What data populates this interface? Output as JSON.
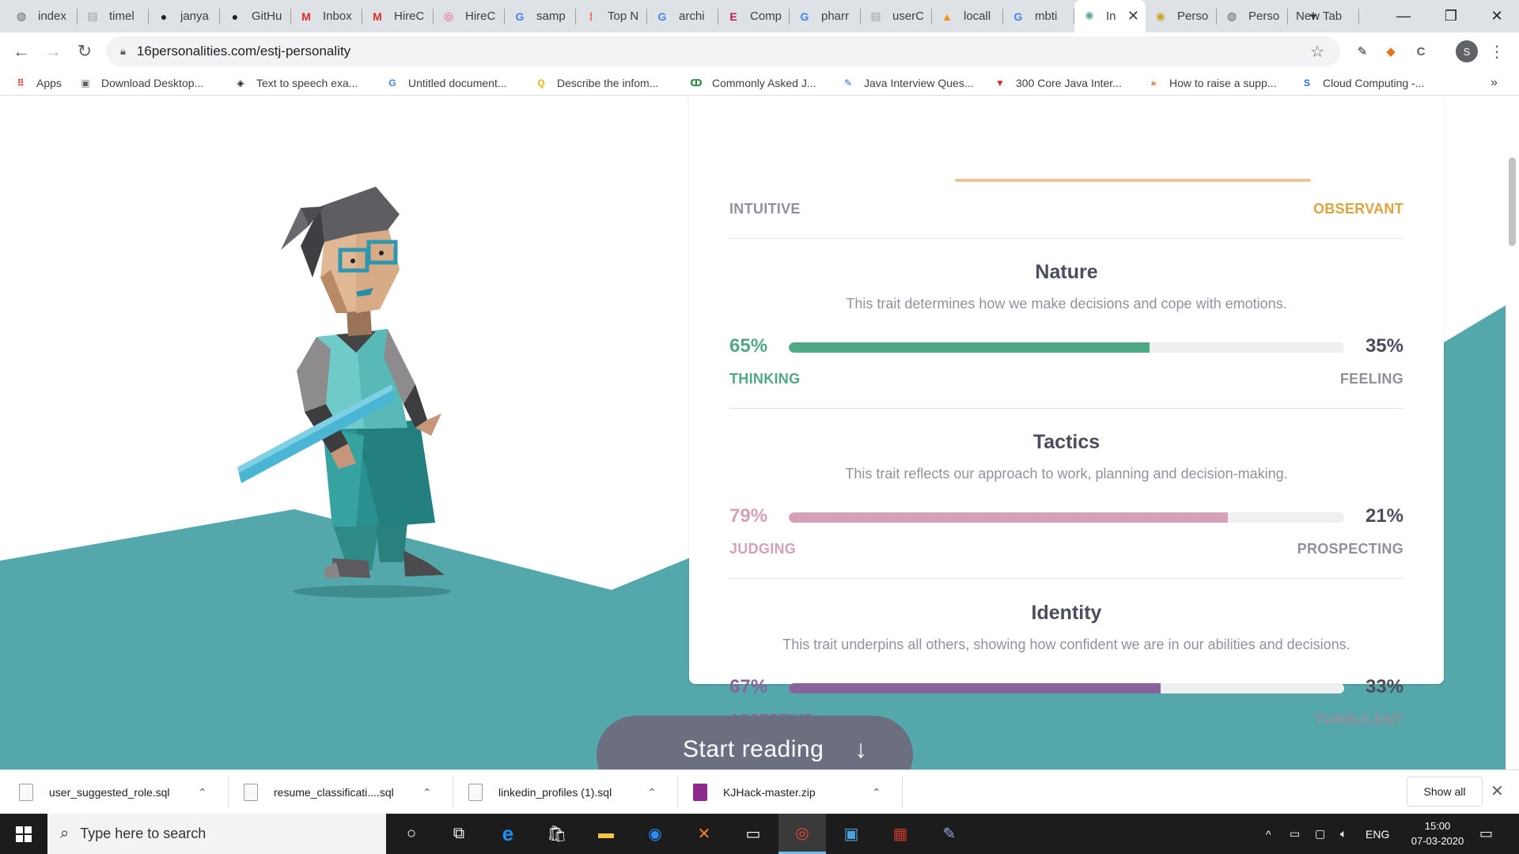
{
  "browser": {
    "tabs": [
      {
        "label": "index",
        "icon": "globe-icon",
        "glyph": "◍",
        "color": "#5f6368"
      },
      {
        "label": "timel",
        "icon": "doc-icon",
        "glyph": "▤",
        "color": "#9aa0a6"
      },
      {
        "label": "janya",
        "icon": "github-icon",
        "glyph": "●",
        "color": "#202124"
      },
      {
        "label": "GitHu",
        "icon": "github-icon",
        "glyph": "●",
        "color": "#202124"
      },
      {
        "label": "Inbox",
        "icon": "gmail-icon",
        "glyph": "M",
        "color": "#d93025"
      },
      {
        "label": "HireC",
        "icon": "gmail-icon",
        "glyph": "M",
        "color": "#d93025"
      },
      {
        "label": "HireC",
        "icon": "dribbble-icon",
        "glyph": "◎",
        "color": "#ea4c89"
      },
      {
        "label": "samp",
        "icon": "google-icon",
        "glyph": "G",
        "color": "#4285f4"
      },
      {
        "label": "Top N",
        "icon": "chart-icon",
        "glyph": "⁞",
        "color": "#f4511e"
      },
      {
        "label": "archi",
        "icon": "google-icon",
        "glyph": "G",
        "color": "#4285f4"
      },
      {
        "label": "Comp",
        "icon": "e-icon",
        "glyph": "E",
        "color": "#c2185b"
      },
      {
        "label": "pharr",
        "icon": "google-icon",
        "glyph": "G",
        "color": "#4285f4"
      },
      {
        "label": "userC",
        "icon": "doc-icon",
        "glyph": "▤",
        "color": "#9aa0a6"
      },
      {
        "label": "locall",
        "icon": "pma-icon",
        "glyph": "▲",
        "color": "#f29111"
      },
      {
        "label": "mbti",
        "icon": "google-icon",
        "glyph": "G",
        "color": "#4285f4"
      },
      {
        "label": "In",
        "icon": "16p-icon",
        "glyph": "✺",
        "color": "#5fa8a0"
      },
      {
        "label": "Perso",
        "icon": "lightbulb-icon",
        "glyph": "◉",
        "color": "#c9a227"
      },
      {
        "label": "Perso",
        "icon": "globe-icon",
        "glyph": "◍",
        "color": "#5f6368"
      },
      {
        "label": "New Tab",
        "icon": "",
        "glyph": "",
        "color": ""
      }
    ],
    "new_tab_symbol": "+",
    "window_controls": {
      "minimize": "—",
      "maximize": "❐",
      "close": "✕"
    },
    "nav": {
      "back": "←",
      "forward": "→",
      "reload": "↻"
    },
    "url": "16personalities.com/estj-personality",
    "profile_initial": "S",
    "bookmarks": [
      {
        "label": "Apps",
        "icon": "apps-icon",
        "glyph": "⠿",
        "color": "#ea4335"
      },
      {
        "label": "Download Desktop...",
        "icon": "page-icon",
        "glyph": "▣",
        "color": "#5f6368"
      },
      {
        "label": "Text to speech exa...",
        "icon": "codepen-icon",
        "glyph": "◈",
        "color": "#202124"
      },
      {
        "label": "Untitled document...",
        "icon": "google-icon",
        "glyph": "G",
        "color": "#4285f4"
      },
      {
        "label": "Describe the infom...",
        "icon": "quora-icon",
        "glyph": "Q",
        "color": "#f4b400"
      },
      {
        "label": "Commonly Asked J...",
        "icon": "gfg-icon",
        "glyph": "ↀ",
        "color": "#2f8d46"
      },
      {
        "label": "Java Interview Ques...",
        "icon": "java-icon",
        "glyph": "✎",
        "color": "#1a73e8"
      },
      {
        "label": "300 Core Java Inter...",
        "icon": "vertex-icon",
        "glyph": "▼",
        "color": "#d93025"
      },
      {
        "label": "How to raise a supp...",
        "icon": "orange-icon",
        "glyph": "»",
        "color": "#f4511e"
      },
      {
        "label": "Cloud Computing -...",
        "icon": "s-icon",
        "glyph": "S",
        "color": "#1a73e8"
      }
    ],
    "bookmarks_overflow": "»"
  },
  "card": {
    "top_left_label": "INTUITIVE",
    "top_right_label": "OBSERVANT",
    "sections": [
      {
        "title": "Nature",
        "description": "This trait determines how we make decisions and cope with emotions.",
        "left_pct": "65%",
        "right_pct": "35%",
        "left_label": "THINKING",
        "right_label": "FEELING",
        "fill": 0.65,
        "color": "#4fa985"
      },
      {
        "title": "Tactics",
        "description": "This trait reflects our approach to work, planning and decision-making.",
        "left_pct": "79%",
        "right_pct": "21%",
        "left_label": "JUDGING",
        "right_label": "PROSPECTING",
        "fill": 0.79,
        "color": "#d4a1b8"
      },
      {
        "title": "Identity",
        "description": "This trait underpins all others, showing how confident we are in our abilities and decisions.",
        "left_pct": "67%",
        "right_pct": "33%",
        "left_label": "ASSERTIVE",
        "right_label": "TURBULENT",
        "fill": 0.67,
        "color": "#88649c"
      }
    ]
  },
  "cta": {
    "label": "Start reading",
    "arrow": "↓"
  },
  "colors": {
    "teal_bg": "#54a8ab",
    "observant_orange": "#e0a43c",
    "text_gray": "#8f929d"
  },
  "downloads": {
    "items": [
      {
        "name": "user_suggested_role.sql"
      },
      {
        "name": "resume_classificati....sql"
      },
      {
        "name": "linkedin_profiles (1).sql"
      },
      {
        "name": "KJHack-master.zip"
      }
    ],
    "show_all": "Show all",
    "close": "✕"
  },
  "taskbar": {
    "search_placeholder": "Type here to search",
    "tray_lang": "ENG",
    "time": "15:00",
    "date": "07-03-2020"
  }
}
